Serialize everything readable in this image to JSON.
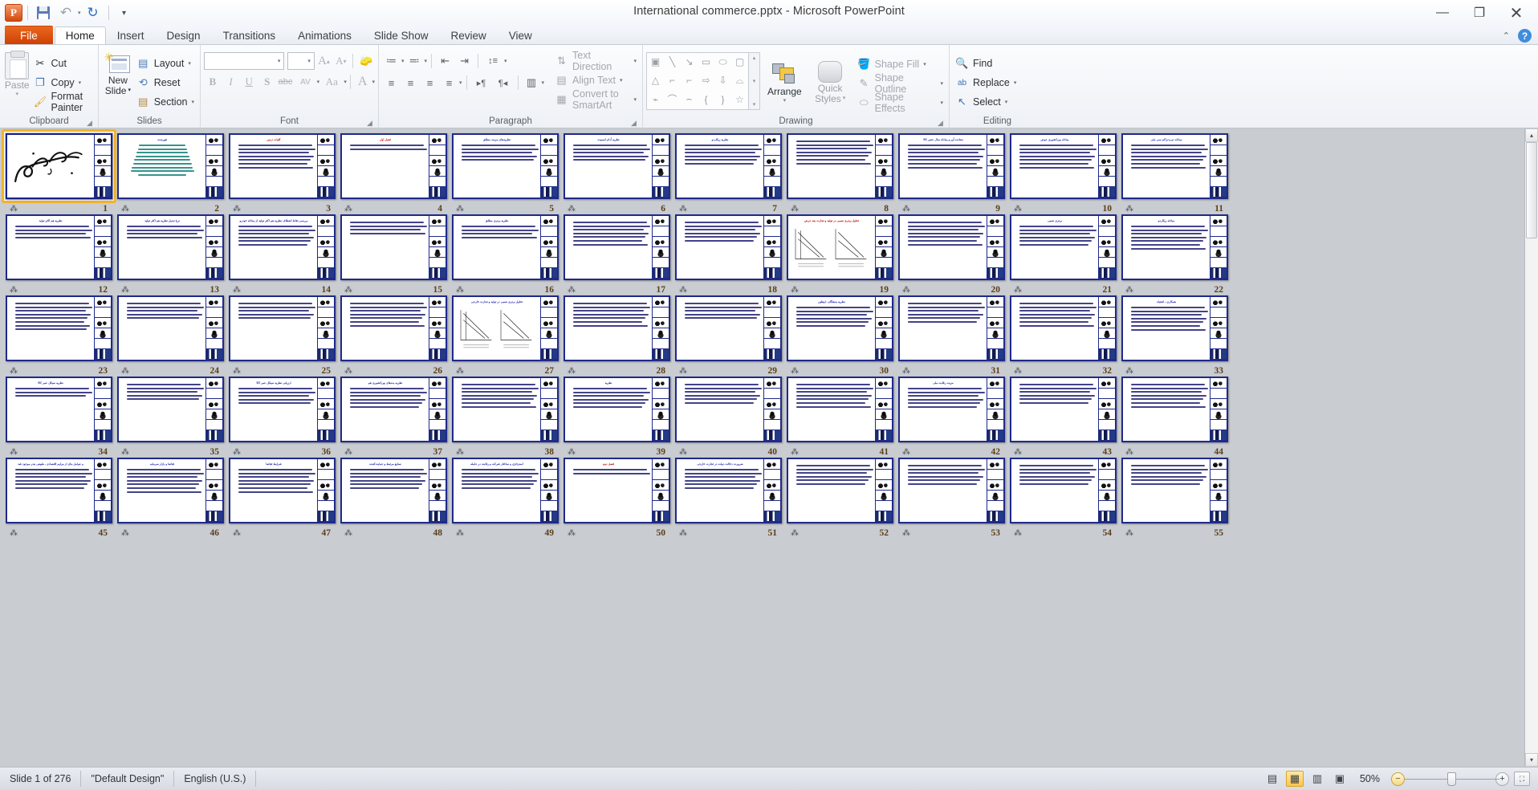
{
  "window": {
    "title": "International commerce.pptx  -  Microsoft PowerPoint",
    "minimize": "—",
    "restore": "❐",
    "close": "✕"
  },
  "qat": {
    "app_logo": "P",
    "save": "save-icon",
    "undo": "↶",
    "undo_caret": "▾",
    "redo": "↻",
    "customize": "▾"
  },
  "tabs": [
    {
      "label": "File",
      "type": "file"
    },
    {
      "label": "Home",
      "type": "active"
    },
    {
      "label": "Insert",
      "type": "normal"
    },
    {
      "label": "Design",
      "type": "normal"
    },
    {
      "label": "Transitions",
      "type": "normal"
    },
    {
      "label": "Animations",
      "type": "normal"
    },
    {
      "label": "Slide Show",
      "type": "normal"
    },
    {
      "label": "Review",
      "type": "normal"
    },
    {
      "label": "View",
      "type": "normal"
    }
  ],
  "ribbon_help": {
    "collapse": "⌃",
    "help": "?"
  },
  "groups": {
    "clipboard": {
      "label": "Clipboard",
      "paste": "Paste",
      "paste_caret": "▾",
      "cut": "Cut",
      "copy": "Copy",
      "copy_caret": "▾",
      "format_painter": "Format Painter",
      "dialog_launcher": "◢"
    },
    "slides": {
      "label": "Slides",
      "new_slide": "New\nSlide",
      "new_slide_line1": "New",
      "new_slide_line2": "Slide",
      "layout": "Layout",
      "reset": "Reset",
      "section": "Section"
    },
    "font": {
      "label": "Font",
      "font_name": "",
      "font_size": "",
      "grow_font": "A",
      "shrink_font": "A",
      "clear_formatting": "Aa",
      "bold": "B",
      "italic": "I",
      "underline": "U",
      "shadow": "S",
      "strikethrough": "abc",
      "character_spacing": "AV",
      "change_case": "Aa",
      "font_color": "A",
      "dialog_launcher": "◢"
    },
    "paragraph": {
      "label": "Paragraph",
      "bullets": "≔",
      "numbering": "≕",
      "decrease_indent": "⇤",
      "increase_indent": "⇥",
      "line_spacing": "↕≡",
      "align_left": "≡",
      "align_center": "≡",
      "align_right": "≡",
      "justify": "≡",
      "ltr": "▸¶",
      "rtl": "¶◂",
      "columns": "▥",
      "text_direction": "Text Direction",
      "align_text": "Align Text",
      "convert_to_smartart": "Convert to SmartArt",
      "dialog_launcher": "◢"
    },
    "drawing": {
      "label": "Drawing",
      "shapes": [
        "▣",
        "╲",
        "↘",
        "▭",
        "⬭",
        "▢",
        "△",
        "⌐",
        "⌐",
        "⇨",
        "⇩",
        "⌓",
        "⌁",
        "⌒",
        "⌢",
        "{",
        "}",
        "☆"
      ],
      "scroll_up": "▴",
      "scroll_down": "▾",
      "scroll_more": "▾",
      "arrange": "Arrange",
      "arrange_caret": "▾",
      "quick_styles_line1": "Quick",
      "quick_styles_line2": "Styles",
      "shape_fill": "Shape Fill",
      "shape_outline": "Shape Outline",
      "shape_effects": "Shape Effects",
      "dialog_launcher": "◢"
    },
    "editing": {
      "label": "Editing",
      "find": "Find",
      "replace": "Replace",
      "select": "Select"
    }
  },
  "status": {
    "slide_counter": "Slide 1 of 276",
    "design": "\"Default Design\"",
    "language": "English (U.S.)",
    "zoom_level": "50%",
    "views": [
      {
        "name": "normal-view",
        "glyph": "▤",
        "active": false
      },
      {
        "name": "slide-sorter-view",
        "glyph": "▦",
        "active": true
      },
      {
        "name": "reading-view",
        "glyph": "▥",
        "active": false
      },
      {
        "name": "slide-show-view",
        "glyph": "▣",
        "active": false
      }
    ],
    "zoom_out": "−",
    "zoom_in": "+",
    "fit_to_window": "⛶"
  },
  "sorter": {
    "selected_slide": 1,
    "slides": [
      {
        "n": 1,
        "kind": "calligraphy",
        "title": "",
        "title_color": "#000080",
        "lines": 0
      },
      {
        "n": 2,
        "kind": "list",
        "title": "فهرست",
        "title_color": "#1f1fb0",
        "lines": 9,
        "line_color": "#0f7a74",
        "align": "center"
      },
      {
        "n": 3,
        "kind": "text",
        "title": "کلیات درس",
        "title_color": "#c00000",
        "lines": 7,
        "line_color": "#1a1a6e",
        "align": "justify"
      },
      {
        "n": 4,
        "kind": "text",
        "title": "فصل اول",
        "title_color": "#c00000",
        "lines": 2,
        "line_color": "#1a1a6e",
        "align": "right"
      },
      {
        "n": 5,
        "kind": "text",
        "title": "نظریه‌های مزیت مطلق",
        "title_color": "#1f1fb0",
        "lines": 5,
        "line_color": "#1a1a6e",
        "align": "justify"
      },
      {
        "n": 6,
        "kind": "text",
        "title": "نظریه آدام اسمیت",
        "title_color": "#1f1fb0",
        "lines": 5,
        "line_color": "#1a1a6e",
        "align": "justify"
      },
      {
        "n": 7,
        "kind": "text",
        "title": "نظریه ریکاردو",
        "title_color": "#1f1fb0",
        "lines": 6,
        "line_color": "#1a1a6e",
        "align": "justify"
      },
      {
        "n": 8,
        "kind": "text",
        "title": "",
        "title_color": "#1f1fb0",
        "lines": 7,
        "line_color": "#1a1a6e",
        "align": "justify"
      },
      {
        "n": 9,
        "kind": "text",
        "title": "ستانده آور و مبادله سال عصر کالا",
        "title_color": "#1f1fb0",
        "lines": 7,
        "line_color": "#1a1a6e",
        "align": "justify"
      },
      {
        "n": 10,
        "kind": "text",
        "title": "مبادله بین‌کشوری عوض",
        "title_color": "#1f1fb0",
        "lines": 7,
        "line_color": "#1a1a6e",
        "align": "justify"
      },
      {
        "n": 11,
        "kind": "text",
        "title": "مبادله دو و تراکم سی ملی",
        "title_color": "#1f1fb0",
        "lines": 7,
        "line_color": "#1a1a6e",
        "align": "justify"
      },
      {
        "n": 12,
        "kind": "text",
        "title": "نظریه هم اکثر تولید",
        "title_color": "#1f1fb0",
        "lines": 4,
        "line_color": "#1a1a6e",
        "align": "justify"
      },
      {
        "n": 13,
        "kind": "text",
        "title": "نرخ تبدیل نظریه هم اکثر تولید",
        "title_color": "#1f1fb0",
        "lines": 4,
        "line_color": "#1a1a6e",
        "align": "justify"
      },
      {
        "n": 14,
        "kind": "text",
        "title": "بررسی نقاط انعطاف نظریه هم اکثر تولید از مبادله خودرو",
        "title_color": "#1f1fb0",
        "lines": 6,
        "line_color": "#1a1a6e",
        "align": "justify"
      },
      {
        "n": 15,
        "kind": "text",
        "title": "",
        "title_color": "#1f1fb0",
        "lines": 4,
        "line_color": "#1a1a6e",
        "align": "justify"
      },
      {
        "n": 16,
        "kind": "text",
        "title": "نظریه برتری مطلق",
        "title_color": "#1f1fb0",
        "lines": 4,
        "line_color": "#1a1a6e",
        "align": "justify"
      },
      {
        "n": 17,
        "kind": "text",
        "title": "",
        "title_color": "#1f1fb0",
        "lines": 7,
        "line_color": "#1a1a6e",
        "align": "justify"
      },
      {
        "n": 18,
        "kind": "text",
        "title": "",
        "title_color": "#1f1fb0",
        "lines": 6,
        "line_color": "#1a1a6e",
        "align": "justify"
      },
      {
        "n": 19,
        "kind": "chart",
        "title": "تحلیل برتری نسبی در تولید و تجارت بعد عرض",
        "title_color": "#c00000",
        "lines": 0
      },
      {
        "n": 20,
        "kind": "text",
        "title": "",
        "title_color": "#1f1fb0",
        "lines": 7,
        "line_color": "#1a1a6e",
        "align": "justify"
      },
      {
        "n": 21,
        "kind": "text",
        "title": "برتری نسبی",
        "title_color": "#1f1fb0",
        "lines": 6,
        "line_color": "#1a1a6e",
        "align": "justify"
      },
      {
        "n": 22,
        "kind": "text",
        "title": "مبادله ریکاردو",
        "title_color": "#1f1fb0",
        "lines": 7,
        "line_color": "#1a1a6e",
        "align": "justify"
      },
      {
        "n": 23,
        "kind": "text",
        "title": "",
        "title_color": "#1f1fb0",
        "lines": 8,
        "line_color": "#1a1a6e",
        "align": "justify"
      },
      {
        "n": 24,
        "kind": "text",
        "title": "",
        "title_color": "#1f1fb0",
        "lines": 5,
        "line_color": "#1a1a6e",
        "align": "justify"
      },
      {
        "n": 25,
        "kind": "text",
        "title": "",
        "title_color": "#1f1fb0",
        "lines": 5,
        "line_color": "#1a1a6e",
        "align": "justify"
      },
      {
        "n": 26,
        "kind": "text",
        "title": "",
        "title_color": "#1f1fb0",
        "lines": 7,
        "line_color": "#1a1a6e",
        "align": "justify"
      },
      {
        "n": 27,
        "kind": "chart",
        "title": "تحلیل برتری نسبی در تولید و تجارت خارجی",
        "title_color": "#1f1fb0",
        "lines": 0
      },
      {
        "n": 28,
        "kind": "text",
        "title": "",
        "title_color": "#1f1fb0",
        "lines": 7,
        "line_color": "#1a1a6e",
        "align": "justify"
      },
      {
        "n": 29,
        "kind": "text",
        "title": "",
        "title_color": "#1f1fb0",
        "lines": 5,
        "line_color": "#1a1a6e",
        "align": "justify"
      },
      {
        "n": 30,
        "kind": "text",
        "title": "نظریه به‌هنگام ـ اوهلین",
        "title_color": "#1f1fb0",
        "lines": 6,
        "line_color": "#1a1a6e",
        "align": "justify"
      },
      {
        "n": 31,
        "kind": "text",
        "title": "",
        "title_color": "#1f1fb0",
        "lines": 6,
        "line_color": "#1a1a6e",
        "align": "justify"
      },
      {
        "n": 32,
        "kind": "text",
        "title": "",
        "title_color": "#1f1fb0",
        "lines": 7,
        "line_color": "#1a1a6e",
        "align": "justify"
      },
      {
        "n": 33,
        "kind": "text",
        "title": "همکاری ـ اشتباه",
        "title_color": "#1f1fb0",
        "lines": 7,
        "line_color": "#1a1a6e",
        "align": "justify"
      },
      {
        "n": 34,
        "kind": "text",
        "title": "نظریه سیکل عمر کالا",
        "title_color": "#1f1fb0",
        "lines": 3,
        "line_color": "#1a1a6e",
        "align": "justify"
      },
      {
        "n": 35,
        "kind": "text",
        "title": "",
        "title_color": "#1f1fb0",
        "lines": 5,
        "line_color": "#1a1a6e",
        "align": "justify"
      },
      {
        "n": 36,
        "kind": "text",
        "title": "ارزیابی نظریه سیکل عمر کالا",
        "title_color": "#1f1fb0",
        "lines": 5,
        "line_color": "#1a1a6e",
        "align": "justify"
      },
      {
        "n": 37,
        "kind": "text",
        "title": "نظریه بده‌های بین‌کشوری هم",
        "title_color": "#1f1fb0",
        "lines": 6,
        "line_color": "#1a1a6e",
        "align": "justify"
      },
      {
        "n": 38,
        "kind": "text",
        "title": "",
        "title_color": "#1f1fb0",
        "lines": 7,
        "line_color": "#1a1a6e",
        "align": "justify"
      },
      {
        "n": 39,
        "kind": "text",
        "title": "نظریه",
        "title_color": "#1f1fb0",
        "lines": 6,
        "line_color": "#1a1a6e",
        "align": "justify"
      },
      {
        "n": 40,
        "kind": "text",
        "title": "",
        "title_color": "#1f1fb0",
        "lines": 6,
        "line_color": "#1a1a6e",
        "align": "justify"
      },
      {
        "n": 41,
        "kind": "text",
        "title": "",
        "title_color": "#1f1fb0",
        "lines": 7,
        "line_color": "#1a1a6e",
        "align": "justify"
      },
      {
        "n": 42,
        "kind": "text",
        "title": "مزیت رقابت ملی",
        "title_color": "#1f1fb0",
        "lines": 6,
        "line_color": "#1a1a6e",
        "align": "justify"
      },
      {
        "n": 43,
        "kind": "text",
        "title": "",
        "title_color": "#1f1fb0",
        "lines": 6,
        "line_color": "#1a1a6e",
        "align": "justify"
      },
      {
        "n": 44,
        "kind": "text",
        "title": "",
        "title_color": "#1f1fb0",
        "lines": 7,
        "line_color": "#1a1a6e",
        "align": "justify"
      },
      {
        "n": 45,
        "kind": "text",
        "title": "و عوامل بنای از مزایم اقتصادی ـ طبیعی بندر موجود شد",
        "title_color": "#1f1fb0",
        "lines": 6,
        "line_color": "#1a1a6e",
        "align": "justify"
      },
      {
        "n": 46,
        "kind": "text",
        "title": "تقاضا و بازار سرمایه",
        "title_color": "#1f1fb0",
        "lines": 7,
        "line_color": "#1a1a6e",
        "align": "justify"
      },
      {
        "n": 47,
        "kind": "text",
        "title": "شرایط تقاضا",
        "title_color": "#1f1fb0",
        "lines": 7,
        "line_color": "#1a1a6e",
        "align": "justify"
      },
      {
        "n": 48,
        "kind": "text",
        "title": "صنایع مرتبط و حمایت‌کننده",
        "title_color": "#1f1fb0",
        "lines": 6,
        "line_color": "#1a1a6e",
        "align": "justify"
      },
      {
        "n": 49,
        "kind": "text",
        "title": "استراتژی و ساختار شرکت و رقابت در عامله",
        "title_color": "#1f1fb0",
        "lines": 6,
        "line_color": "#1a1a6e",
        "align": "justify"
      },
      {
        "n": 50,
        "kind": "text",
        "title": "فصل دوم",
        "title_color": "#c00000",
        "lines": 2,
        "line_color": "#1a1a6e",
        "align": "right"
      },
      {
        "n": 51,
        "kind": "text",
        "title": "ضرورت دخالت دولت در تجارت خارجی",
        "title_color": "#1f1fb0",
        "lines": 6,
        "line_color": "#1a1a6e",
        "align": "justify"
      },
      {
        "n": 52,
        "kind": "text",
        "title": "",
        "title_color": "#1f1fb0",
        "lines": 6,
        "line_color": "#1a1a6e",
        "align": "justify"
      },
      {
        "n": 53,
        "kind": "text",
        "title": "",
        "title_color": "#1f1fb0",
        "lines": 6,
        "line_color": "#1a1a6e",
        "align": "justify"
      },
      {
        "n": 54,
        "kind": "text",
        "title": "",
        "title_color": "#1f1fb0",
        "lines": 6,
        "line_color": "#1a1a6e",
        "align": "justify"
      },
      {
        "n": 55,
        "kind": "text",
        "title": "",
        "title_color": "#1f1fb0",
        "lines": 6,
        "line_color": "#1a1a6e",
        "align": "justify"
      }
    ]
  }
}
